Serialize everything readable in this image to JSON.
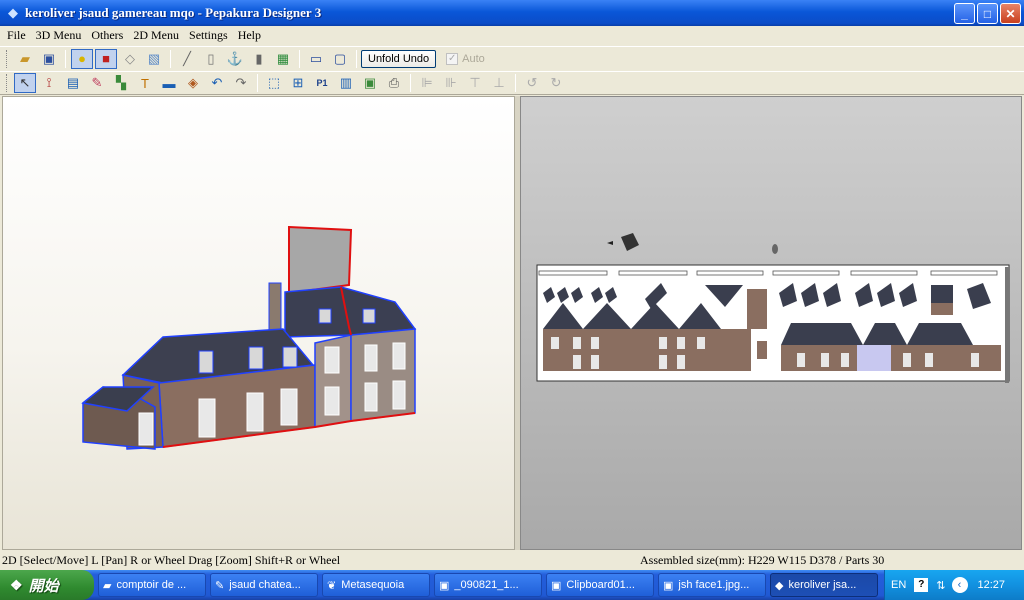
{
  "window": {
    "title": "keroliver jsaud gamereau mqo - Pepakura Designer 3",
    "app_icon": "pepakura-icon",
    "buttons": {
      "minimize": "_",
      "maximize": "□",
      "close": "✕"
    }
  },
  "menu": [
    "File",
    "3D Menu",
    "Others",
    "2D Menu",
    "Settings",
    "Help"
  ],
  "toolbar1": {
    "icons": [
      "open-icon",
      "save-icon",
      "light-icon",
      "texture-icon",
      "wireframe-icon",
      "box-icon",
      "edge-icon",
      "cylinder-icon",
      "anchor-icon",
      "shape-icon",
      "layout-icon",
      "single-view-icon",
      "dual-view-icon"
    ],
    "unfold_undo": "Unfold Undo",
    "auto_label": "Auto",
    "auto_checked": true
  },
  "toolbar2": {
    "icons": [
      "select-icon",
      "join-icon",
      "grid-icon",
      "paint-icon",
      "glue-icon",
      "text-icon",
      "image-icon",
      "rotate-part-icon",
      "undo-icon",
      "redo-icon",
      "fit-icon",
      "arrange-icon",
      "page-icon",
      "print-setup-icon",
      "print-icon",
      "align-left-icon",
      "align-center-icon",
      "align-top-icon",
      "align-bottom-icon",
      "rotate-left-90-icon",
      "rotate-right-90-icon"
    ]
  },
  "status": {
    "left": "2D [Select/Move] L [Pan] R or Wheel Drag [Zoom] Shift+R or Wheel",
    "right": "Assembled size(mm): H229 W115 D378 / Parts 30"
  },
  "taskbar": {
    "start": "開始",
    "items": [
      {
        "label": "comptoir de ...",
        "icon": "folder-icon"
      },
      {
        "label": "jsaud chatea...",
        "icon": "pencil-icon"
      },
      {
        "label": "Metasequoia",
        "icon": "leaf-icon"
      },
      {
        "label": "_090821_1...",
        "icon": "image-icon"
      },
      {
        "label": "Clipboard01...",
        "icon": "image-icon"
      },
      {
        "label": "jsh face1.jpg...",
        "icon": "image-icon"
      },
      {
        "label": "keroliver jsa...",
        "icon": "pepakura-icon",
        "active": true
      }
    ],
    "lang": "EN",
    "help": "?",
    "clock": "12:27"
  }
}
